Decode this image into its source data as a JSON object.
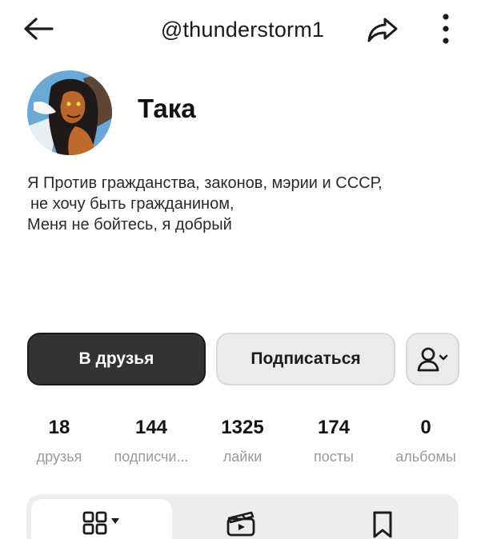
{
  "header": {
    "username": "@thunderstorm1",
    "back_icon": "arrow-left-icon",
    "share_icon": "share-arrow-icon",
    "more_icon": "more-vertical-icon"
  },
  "profile": {
    "display_name": "Така",
    "bio": [
      "Я Против гражданства, законов, мэрии и СССР,",
      "не хочу быть гражданином,",
      "Меня не бойтесь, я добрый"
    ]
  },
  "actions": {
    "friend_label": "В друзья",
    "subscribe_label": "Подписаться",
    "add_friend_icon": "user-add-dropdown-icon"
  },
  "stats": [
    {
      "value": "18",
      "label": "друзья"
    },
    {
      "value": "144",
      "label": "подписчи..."
    },
    {
      "value": "1325",
      "label": "лайки"
    },
    {
      "value": "174",
      "label": "посты"
    },
    {
      "value": "0",
      "label": "альбомы"
    }
  ],
  "tabs": {
    "grid_icon": "grid-icon",
    "clips_icon": "clapperboard-icon",
    "saved_icon": "bookmark-icon"
  },
  "colors": {
    "primary_button": "#333333",
    "secondary_button": "#ebebeb",
    "muted_text": "#9a9a9a",
    "tabbar_bg": "#ededed"
  }
}
